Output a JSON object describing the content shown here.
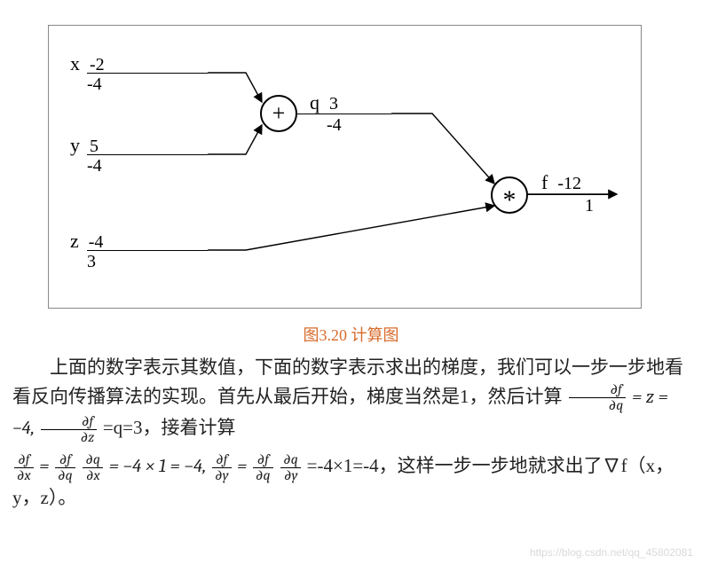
{
  "caption": "图3.20 计算图",
  "nodes": {
    "plus": "+",
    "mul": "*"
  },
  "inputs": {
    "x": {
      "name": "x",
      "val": "-2",
      "grad": "-4"
    },
    "y": {
      "name": "y",
      "val": "5",
      "grad": "-4"
    },
    "z": {
      "name": "z",
      "val": "-4",
      "grad": "3"
    }
  },
  "q": {
    "name": "q",
    "val": "3",
    "grad": "-4"
  },
  "f": {
    "name": "f",
    "val": "-12",
    "grad": "1"
  },
  "text": {
    "p1a": "上面的数字表示其数值，下面的数字表示求出的梯度，我们可以一步一步地看看反向传播算法的实现。首先从最后开始，梯度当然是1，然后计算",
    "p1b": "=q=3，接着计算",
    "p2b": "=-4×1=-4，这样一步一步地就求出了∇f（x，y，z）。"
  },
  "eq": {
    "dfdq": "∂f",
    "dq": "∂q",
    "dfdz": "∂f",
    "dz": "∂z",
    "dfdx": "∂f",
    "dx": "∂x",
    "dfdy": "∂f",
    "dy": "∂y",
    "dqdx": "∂q",
    "dqdy": "∂q",
    "eqz": " = z = −4, ",
    "eqx": " = −4 × 1 = −4, ",
    "eqeq": " = "
  },
  "watermark": "https://blog.csdn.net/qq_45802081"
}
